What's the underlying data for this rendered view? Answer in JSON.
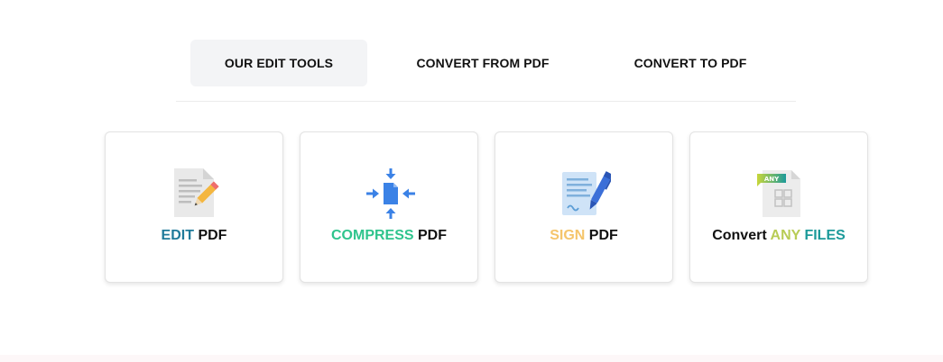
{
  "tabs": [
    {
      "label": "OUR EDIT TOOLS",
      "active": true
    },
    {
      "label": "CONVERT FROM PDF",
      "active": false
    },
    {
      "label": "CONVERT TO PDF",
      "active": false
    }
  ],
  "tools": [
    {
      "icon": "edit-pdf-icon",
      "highlight": "EDIT",
      "highlight_first": true,
      "rest": " PDF",
      "highlight_color": "#1f7a9a"
    },
    {
      "icon": "compress-pdf-icon",
      "highlight": "COMPRESS",
      "highlight_first": true,
      "rest": " PDF",
      "highlight_color": "#2fc48d"
    },
    {
      "icon": "sign-pdf-icon",
      "highlight": "SIGN",
      "highlight_first": true,
      "rest": " PDF",
      "highlight_color": "#f5c56b"
    },
    {
      "icon": "convert-any-icon",
      "prefix": "Convert ",
      "highlight_a": "ANY",
      "highlight_b": " FILES",
      "highlight_a_color": "#b8cc55",
      "highlight_b_color": "#1c9a9a"
    }
  ],
  "any_badge": "ANY"
}
